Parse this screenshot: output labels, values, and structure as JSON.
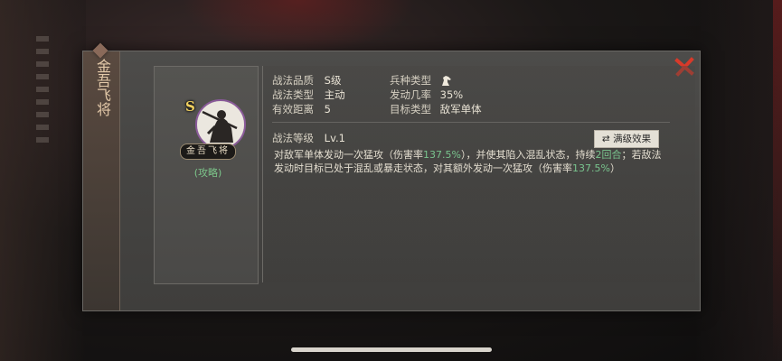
{
  "skill": {
    "name": "金吾飞将",
    "name_plate": "金吾飞将",
    "guide_link": "(攻略)",
    "grade_badge": "S"
  },
  "attributes": {
    "quality_label": "战法品质",
    "quality_value": "S级",
    "troop_label": "兵种类型",
    "troop_icon": "horse-icon",
    "type_label": "战法类型",
    "type_value": "主动",
    "rate_label": "发动几率",
    "rate_value": "35%",
    "range_label": "有效距离",
    "range_value": "5",
    "target_label": "目标类型",
    "target_value": "敌军单体"
  },
  "level": {
    "label": "战法等级",
    "value": "Lv.1",
    "full_effect_button": "满级效果"
  },
  "description": {
    "p1": "对敌军单体发动一次猛攻（伤害率",
    "d1": "137.5%",
    "p2": "），并使其陷入混乱状态，持续",
    "d2": "2回合",
    "p3": "；若敌法发动时目标已处于混乱或暴走状态，对其额外发动一次猛攻（伤害率",
    "d3": "137.5%",
    "p4": "）"
  },
  "colors": {
    "highlight": "#79c48e",
    "close": "#d83a2a",
    "avatar_ring": "#8a5a9a"
  }
}
